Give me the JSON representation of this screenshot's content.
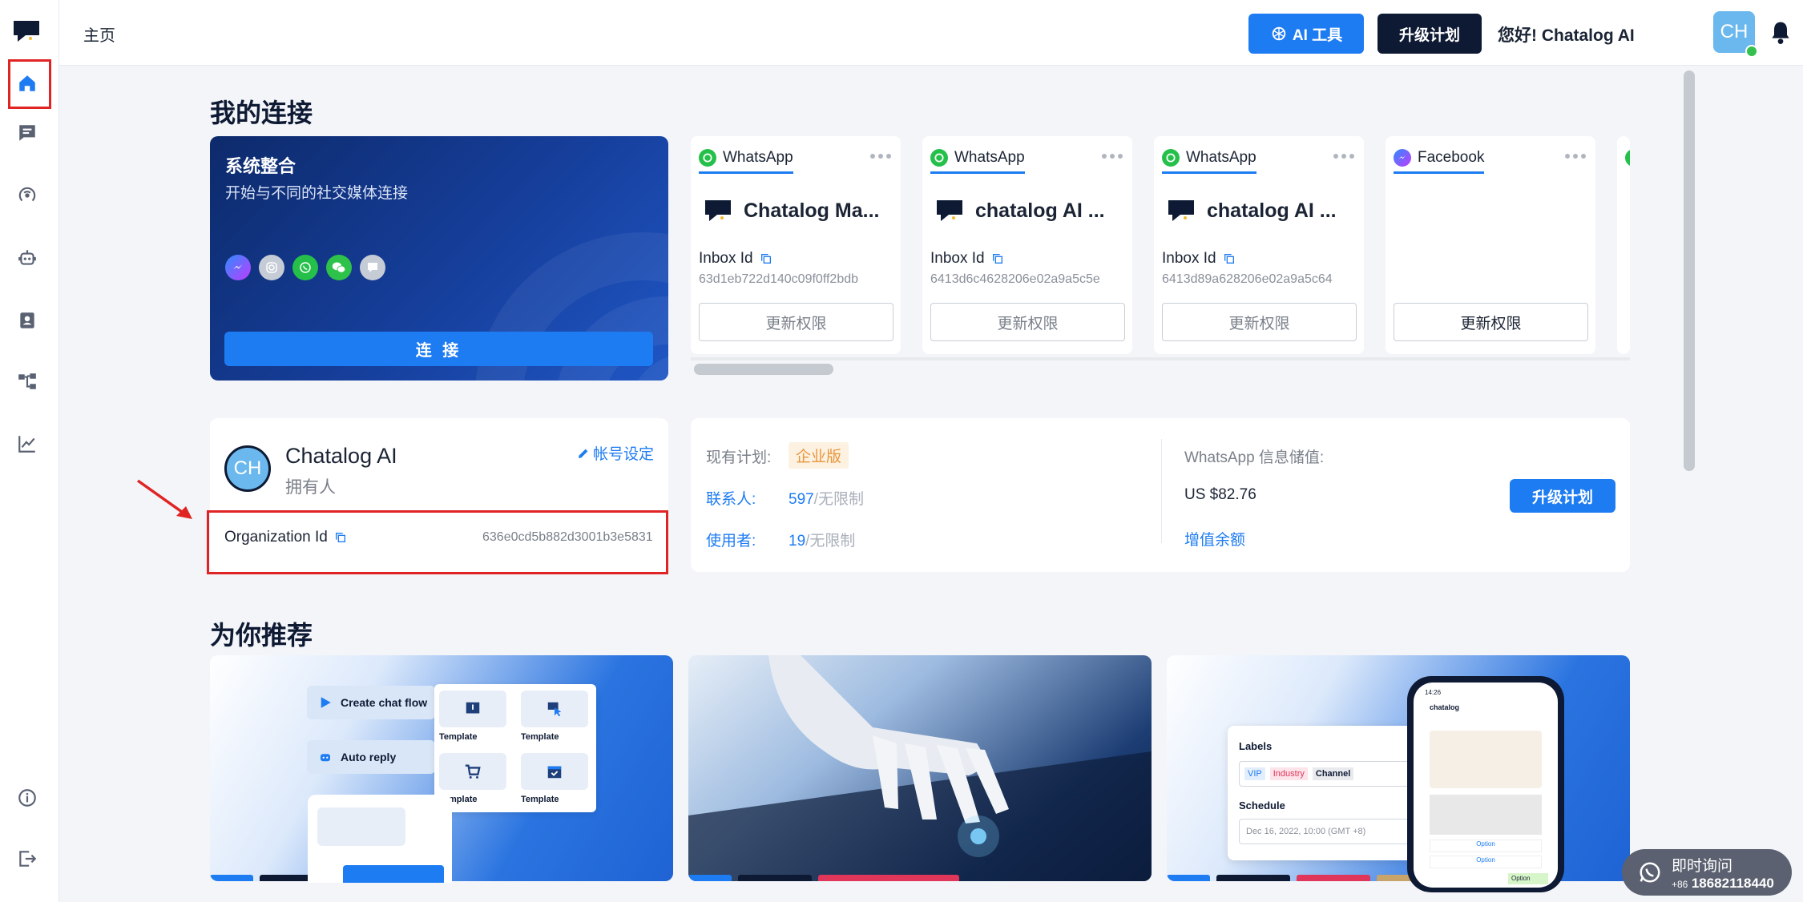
{
  "header": {
    "breadcrumb": "主页",
    "ai_tools_label": "AI 工具",
    "upgrade_label": "升级计划",
    "greeting": "您好! Chatalog AI",
    "avatar_initials": "CH"
  },
  "sidebar": {
    "items": [
      {
        "icon": "home-icon"
      },
      {
        "icon": "chat-icon"
      },
      {
        "icon": "broadcast-icon"
      },
      {
        "icon": "bot-icon"
      },
      {
        "icon": "contacts-icon"
      },
      {
        "icon": "flow-icon"
      },
      {
        "icon": "analytics-icon"
      },
      {
        "icon": "info-icon"
      },
      {
        "icon": "logout-icon"
      }
    ]
  },
  "connections": {
    "title": "我的连接",
    "integration": {
      "title": "系统整合",
      "subtitle": "开始与不同的社交媒体连接",
      "connect_label": "连 接"
    },
    "inboxes": [
      {
        "channel": "WhatsApp",
        "name": "Chatalog Ma...",
        "id_label": "Inbox Id",
        "id": "63d1eb722d140c09f0ff2bdb",
        "permission_label": "更新权限"
      },
      {
        "channel": "WhatsApp",
        "name": "chatalog AI ...",
        "id_label": "Inbox Id",
        "id": "6413d6c4628206e02a9a5c5e",
        "permission_label": "更新权限"
      },
      {
        "channel": "WhatsApp",
        "name": "chatalog AI ...",
        "id_label": "Inbox Id",
        "id": "6413d89a628206e02a9a5c64",
        "permission_label": "更新权限"
      },
      {
        "channel": "Facebook",
        "name": "",
        "id_label": "",
        "id": "",
        "permission_label": "更新权限"
      }
    ]
  },
  "account": {
    "avatar_initials": "CH",
    "name": "Chatalog AI",
    "role": "拥有人",
    "settings_label": "帐号设定",
    "org_id_label": "Organization Id",
    "org_id": "636e0cd5b882d3001b3e5831"
  },
  "plan": {
    "current_plan_label": "现有计划:",
    "current_plan": "企业版",
    "contacts_label": "联系人:",
    "contacts_value": "597",
    "contacts_limit": "/无限制",
    "users_label": "使用者:",
    "users_value": "19",
    "users_limit": "/无限制",
    "wa_balance_label": "WhatsApp 信息储值:",
    "wa_balance": "US $82.76",
    "upgrade_label": "升级计划",
    "topup_label": "增值余额"
  },
  "recommend": {
    "title": "为你推荐",
    "card1": {
      "create_flow": "Create chat flow",
      "auto_reply": "Auto reply",
      "templates": [
        "Template",
        "Template",
        "Template",
        "Template"
      ]
    },
    "card3": {
      "labels_title": "Labels",
      "tags": [
        "VIP",
        "Industry",
        "Channel"
      ],
      "schedule_title": "Schedule",
      "schedule_value": "Dec 16, 2022, 10:00 (GMT +8)",
      "phone_app": "chatalog",
      "phone_time": "14:26",
      "option_label": "Option"
    }
  },
  "chat_widget": {
    "title": "即时询问",
    "phone_prefix": "+86",
    "phone": "18682118440"
  },
  "colors": {
    "primary": "#1e7cf2",
    "dark": "#0e1a33",
    "whatsapp": "#25c04a",
    "highlight": "#e02424"
  }
}
